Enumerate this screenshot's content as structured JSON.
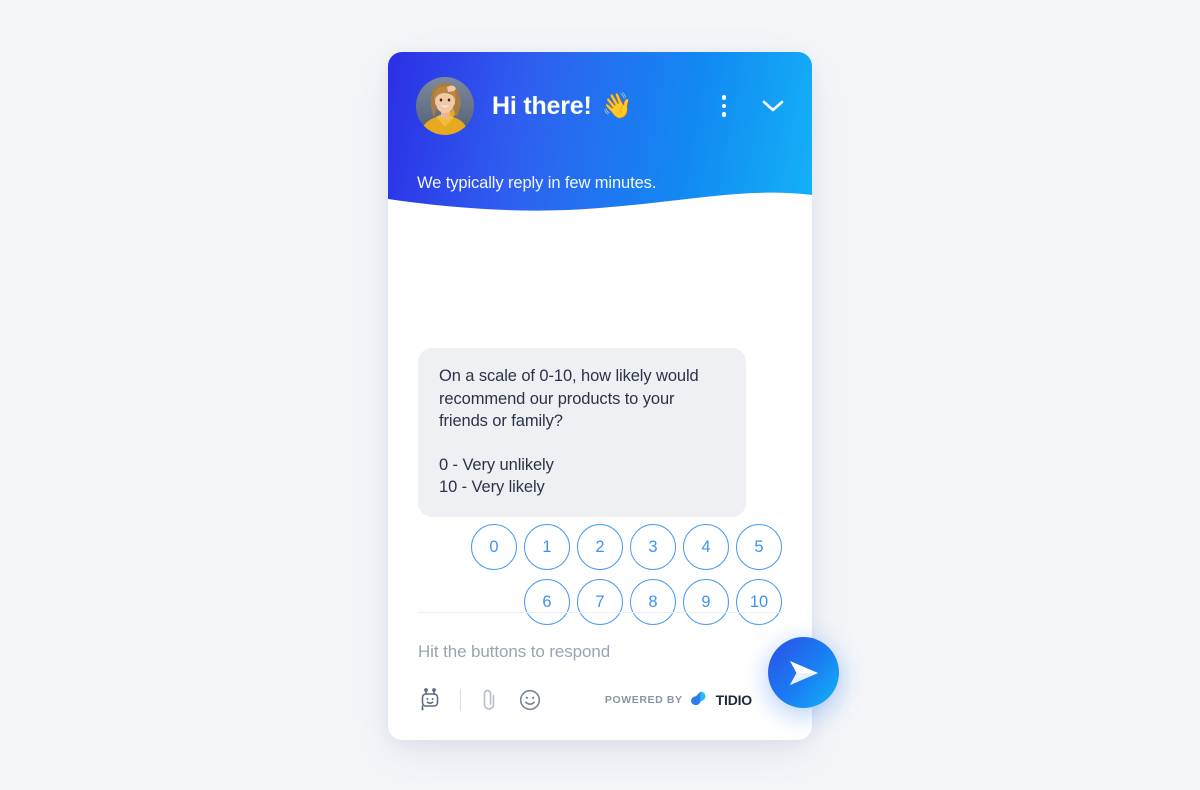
{
  "page": {
    "background_color": "#f4f6f9"
  },
  "widget": {
    "header": {
      "greeting": "Hi there!",
      "wave_emoji": "👋",
      "avatar_alt": "agent-avatar",
      "subtitle": "We typically reply in few minutes.",
      "menu_icon": "kebab-menu-icon",
      "collapse_icon": "chevron-down-icon",
      "gradient_start": "#2b2fe6",
      "gradient_end": "#14b2f7"
    },
    "conversation": {
      "bot_message": {
        "question": "On a scale of 0-10, how likely would recommend our products to your friends or family?",
        "legend_low": "0 - Very unlikely",
        "legend_high": "10 - Very likely",
        "bubble_color": "#eff0f4",
        "text_color": "#2b3346"
      },
      "rating": {
        "accent_color": "#3d93f0",
        "rows": [
          [
            "0",
            "1",
            "2",
            "3",
            "4",
            "5"
          ],
          [
            "6",
            "7",
            "8",
            "9",
            "10"
          ]
        ]
      }
    },
    "footer": {
      "input_placeholder": "Hit the buttons to respond",
      "tools": [
        {
          "name": "bot-icon",
          "label": "Chatbot"
        },
        {
          "name": "attachment-icon",
          "label": "Attach file"
        },
        {
          "name": "emoji-icon",
          "label": "Emoji"
        }
      ],
      "powered_by": {
        "label": "POWERED BY",
        "brand": "TIDIO",
        "logo_icon": "tidio-logo-icon"
      },
      "send_button": {
        "icon": "send-plane-icon",
        "color_start": "#2b4fe8",
        "color_end": "#12b6f8"
      }
    }
  }
}
